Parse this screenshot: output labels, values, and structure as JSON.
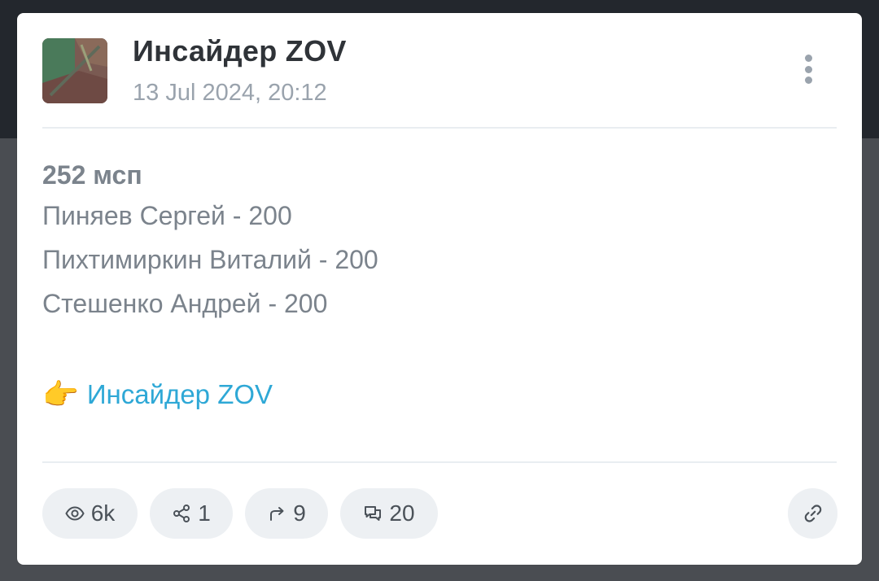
{
  "post": {
    "channel_name": "Инсайдер ZOV",
    "date": "13 Jul 2024, 20:12",
    "title": "252 мсп",
    "lines": [
      "Пиняев Сергей - 200",
      "Пихтимиркин Виталий - 200",
      "Стешенко Андрей - 200"
    ],
    "link_emoji": "👉",
    "link_text": "Инсайдер ZOV"
  },
  "stats": {
    "views": "6k",
    "shares": "1",
    "forwards": "9",
    "comments": "20"
  },
  "icons": {
    "views": "eye-icon",
    "shares": "share-icon",
    "forwards": "forward-arrow-icon",
    "comments": "comments-icon",
    "link": "link-icon",
    "menu": "more-vertical-icon"
  },
  "colors": {
    "link": "#2ea8d6",
    "chip_background": "#edf0f3",
    "muted_text": "#9aa3ad",
    "body_text": "#7b838c",
    "title_text": "#2f3338"
  }
}
